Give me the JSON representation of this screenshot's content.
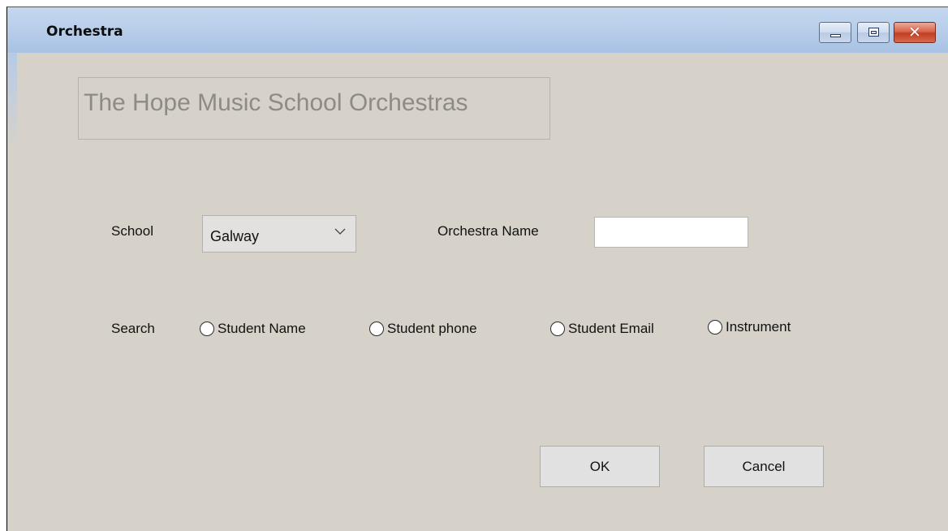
{
  "window": {
    "title": "Orchestra",
    "controls": {
      "minimize_icon": "minimize-icon",
      "maximize_icon": "maximize-icon",
      "close_icon": "close-icon",
      "close_glyph": "✕"
    },
    "colors": {
      "titlebar": "#b9cfea",
      "background": "#d6d2ca",
      "close_button": "#c94a2c"
    }
  },
  "heading": {
    "text": "The Hope Music School Orchestras"
  },
  "form": {
    "school_label": "School",
    "school_value": "Galway",
    "orchestra_name_label": "Orchestra Name",
    "orchestra_name_value": "",
    "search_label": "Search",
    "search_options": [
      {
        "label": "Student Name",
        "selected": false
      },
      {
        "label": "Student phone",
        "selected": false
      },
      {
        "label": "Student Email",
        "selected": false
      },
      {
        "label": "Instrument",
        "selected": false
      }
    ]
  },
  "buttons": {
    "ok_label": "OK",
    "cancel_label": "Cancel"
  }
}
